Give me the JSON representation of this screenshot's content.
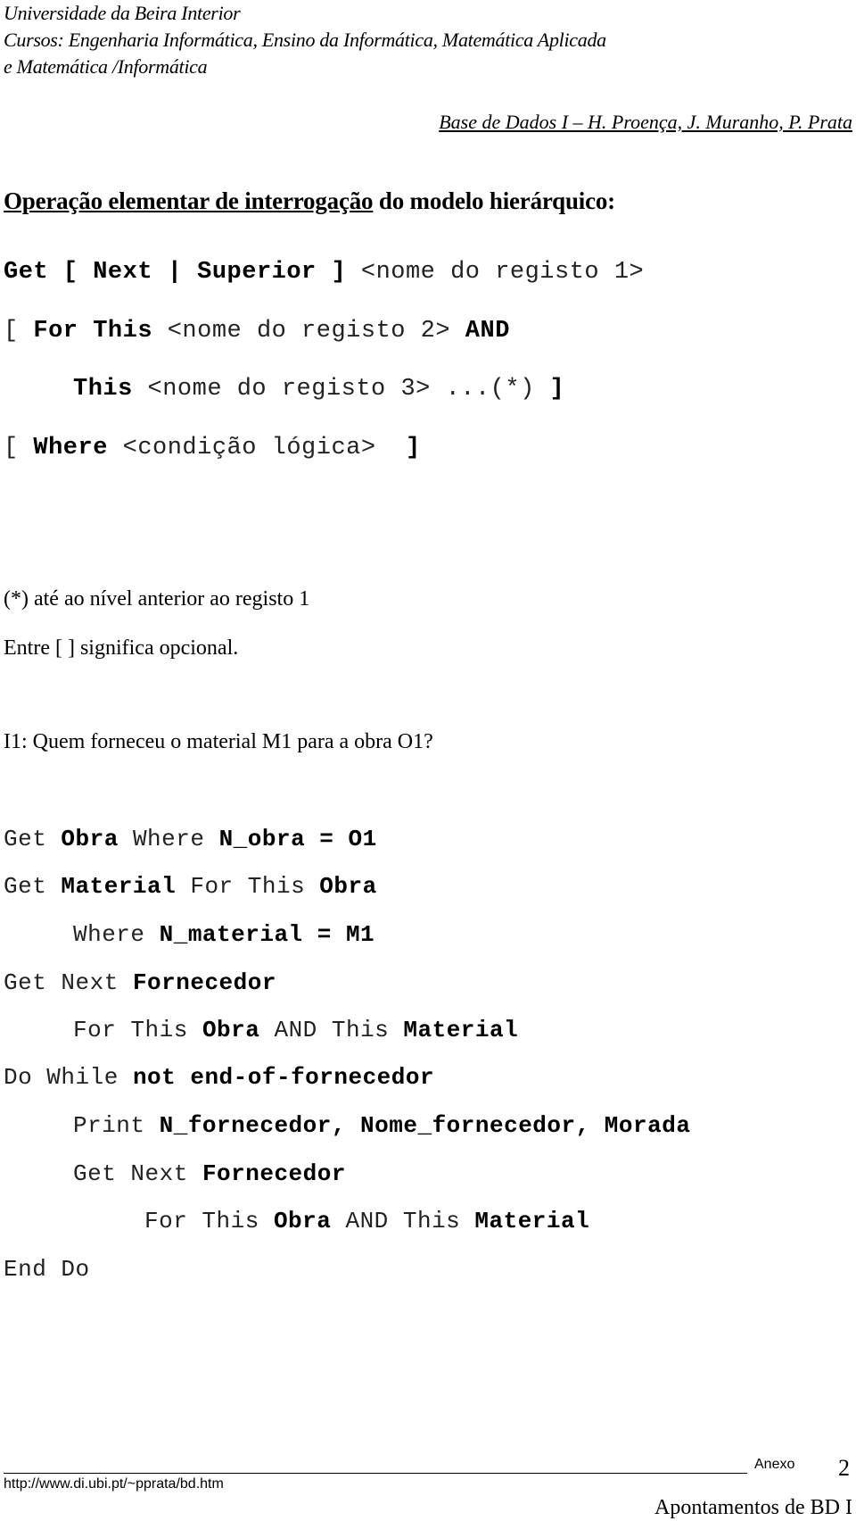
{
  "header": {
    "university": "Universidade da Beira Interior",
    "courses_line1": "Cursos: Engenharia Informática, Ensino da Informática, Matemática Aplicada",
    "courses_line2": "e Matemática /Informática",
    "course_title": "Base de Dados I – H. Proença, J. Muranho, P. Prata"
  },
  "section": {
    "title_underlined": "Operação elementar de interrogação",
    "title_rest": " do modelo hierárquico:"
  },
  "syntax": {
    "line1": {
      "get": "Get",
      "open": " [ ",
      "next": "Next",
      "bar": " | ",
      "superior": "Superior",
      "close": " ]",
      "rec": " <nome do registo 1>"
    },
    "line2": {
      "open": "[ ",
      "for_this": "For This",
      "rec": " <nome do registo 2> ",
      "and": "AND"
    },
    "line3": {
      "this": "This",
      "rec": " <nome do registo 3> ...(*) ",
      "close": "]"
    },
    "line4": {
      "open": "[ ",
      "where": "Where",
      "cond": " <condição lógica>  ",
      "close": "]"
    }
  },
  "notes": {
    "asterisk": "(*) até ao nível anterior ao registo 1",
    "optional": "Entre [  ] significa opcional."
  },
  "question": "I1: Quem forneceu o material M1 para a obra O1?",
  "program": {
    "l1": {
      "a": "Get ",
      "b": "Obra",
      "c": " Where ",
      "d": "N_obra = O1"
    },
    "l2": {
      "a": "Get ",
      "b": "Material",
      "c": " For This ",
      "d": "Obra"
    },
    "l3": {
      "a": "Where ",
      "b": "N_material = M1"
    },
    "l4": {
      "a": "Get Next ",
      "b": "Fornecedor"
    },
    "l5": {
      "a": "For This ",
      "b": "Obra",
      "c": " AND This ",
      "d": "Material"
    },
    "l6": {
      "a": "Do While ",
      "b": "not end-of-fornecedor"
    },
    "l7": {
      "a": "Print ",
      "b": "N_fornecedor, Nome_fornecedor, Morada"
    },
    "l8": {
      "a": "Get Next ",
      "b": "Fornecedor"
    },
    "l9": {
      "a": "For This ",
      "b": "Obra",
      "c": " AND This ",
      "d": "Material"
    },
    "l10": {
      "a": "End Do"
    }
  },
  "footer": {
    "section_label": "Anexo",
    "page_number": "2",
    "url": "http://www.di.ubi.pt/~pprata/bd.htm",
    "document_title": "Apontamentos de BD I"
  }
}
